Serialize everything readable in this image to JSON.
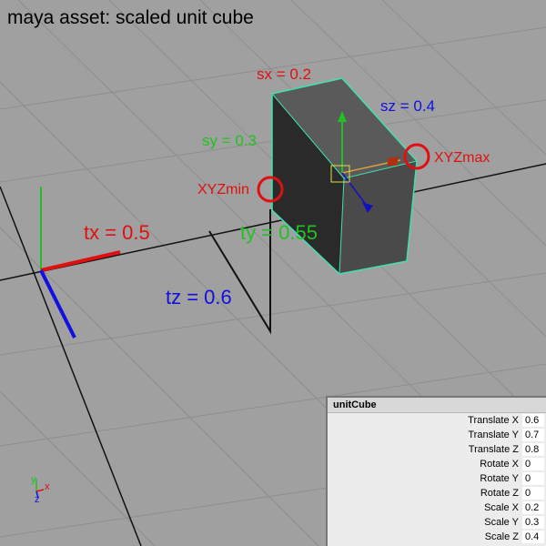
{
  "title": "maya asset: scaled unit cube",
  "annotations": {
    "sx": "sx = 0.2",
    "sy": "sy = 0.3",
    "sz": "sz = 0.4",
    "tx": "tx = 0.5",
    "ty": "ty = 0.55",
    "tz": "tz = 0.6",
    "xyzmin": "XYZmin",
    "xyzmax": "XYZmax"
  },
  "axis_indicator": {
    "x": "x",
    "y": "y",
    "z": "z"
  },
  "channel_box": {
    "object_name": "unitCube",
    "channels": [
      {
        "label": "Translate X",
        "value": "0.6"
      },
      {
        "label": "Translate Y",
        "value": "0.7"
      },
      {
        "label": "Translate Z",
        "value": "0.8"
      },
      {
        "label": "Rotate X",
        "value": "0"
      },
      {
        "label": "Rotate Y",
        "value": "0"
      },
      {
        "label": "Rotate Z",
        "value": "0"
      },
      {
        "label": "Scale X",
        "value": "0.2"
      },
      {
        "label": "Scale Y",
        "value": "0.3"
      },
      {
        "label": "Scale Z",
        "value": "0.4"
      }
    ]
  },
  "colors": {
    "background": "#a0a0a0",
    "grid": "#8e8e8e",
    "x_axis": "#e01010",
    "y_axis": "#22c022",
    "z_axis": "#1010e0",
    "cube_front": "#2e2e2e",
    "cube_top": "#5a5a5a",
    "cube_side": "#4a4a4a",
    "cube_edge": "#40e0b0"
  }
}
